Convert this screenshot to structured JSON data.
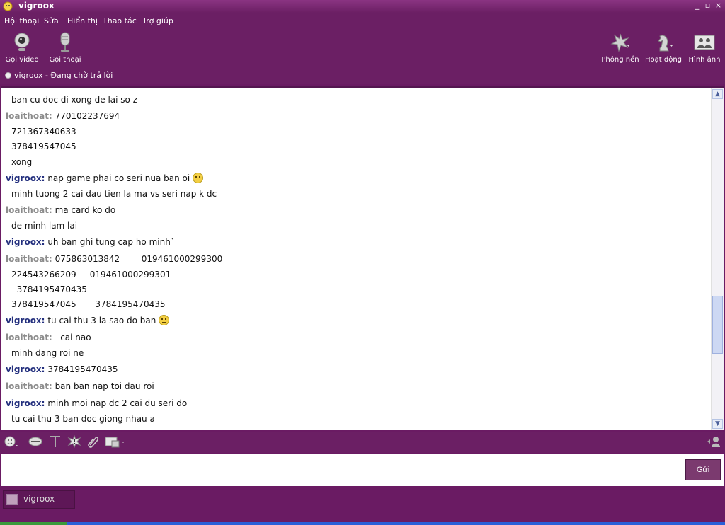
{
  "window": {
    "title": "vigroox",
    "controls": [
      "_",
      "▫",
      "×"
    ]
  },
  "menu": [
    "Hội thoại",
    "Sửa",
    "Hiển thị",
    "Thao tác",
    "Trợ giúp"
  ],
  "toolbar": {
    "video_label": "Gọi video",
    "voice_label": "Gọi thoại",
    "background_label": "Phông nền",
    "activity_label": "Hoạt động",
    "images_label": "Hình ảnh"
  },
  "status": {
    "name": "vigroox",
    "separator": "-",
    "text": "Đang chờ trả lời"
  },
  "messages": [
    {
      "speaker": "",
      "text": "ban cu doc di xong de lai so z"
    },
    {
      "speaker": "loaithoat:",
      "text": "770102237694"
    },
    {
      "speaker": "",
      "text": "721367340633"
    },
    {
      "speaker": "",
      "text": "378419547045"
    },
    {
      "speaker": "",
      "text": "xong"
    },
    {
      "speaker": "vigroox:",
      "text": "nap game phai co seri nua ban oi"
    },
    {
      "speaker": "",
      "text": "minh tuong 2 cai dau tien la ma vs seri nap k dc"
    },
    {
      "speaker": "loaithoat:",
      "text": "ma card ko do"
    },
    {
      "speaker": "",
      "text": "de minh lam lai"
    },
    {
      "speaker": "vigroox:",
      "text": "uh ban ghi tung cap ho minh`"
    },
    {
      "speaker": "loaithoat:",
      "text": "075863013842        019461000299300"
    },
    {
      "speaker": "",
      "text": "224543266209     019461000299301"
    },
    {
      "speaker": "",
      "text": "  3784195470435"
    },
    {
      "speaker": "",
      "text": "378419547045       3784195470435"
    },
    {
      "speaker": "vigroox:",
      "text": "tu cai thu 3 la sao do ban"
    },
    {
      "speaker": "loaithoat:",
      "text": "  cai nao"
    },
    {
      "speaker": "",
      "text": "minh dang roi ne"
    },
    {
      "speaker": "vigroox:",
      "text": "3784195470435"
    },
    {
      "speaker": "loaithoat:",
      "text": "ban ban nap toi dau roi"
    },
    {
      "speaker": "vigroox:",
      "text": "minh moi nap dc 2 cai du seri do"
    },
    {
      "speaker": "",
      "text": "tu cai thu 3 ban doc giong nhau a"
    }
  ],
  "input": {
    "value": "",
    "send_label": "Gửi"
  },
  "tabs": [
    {
      "label": "vigroox"
    }
  ],
  "colors": {
    "chrome": "#6b1f64",
    "speaker_self": "#24307e",
    "speaker_other": "#8c8c8c"
  }
}
